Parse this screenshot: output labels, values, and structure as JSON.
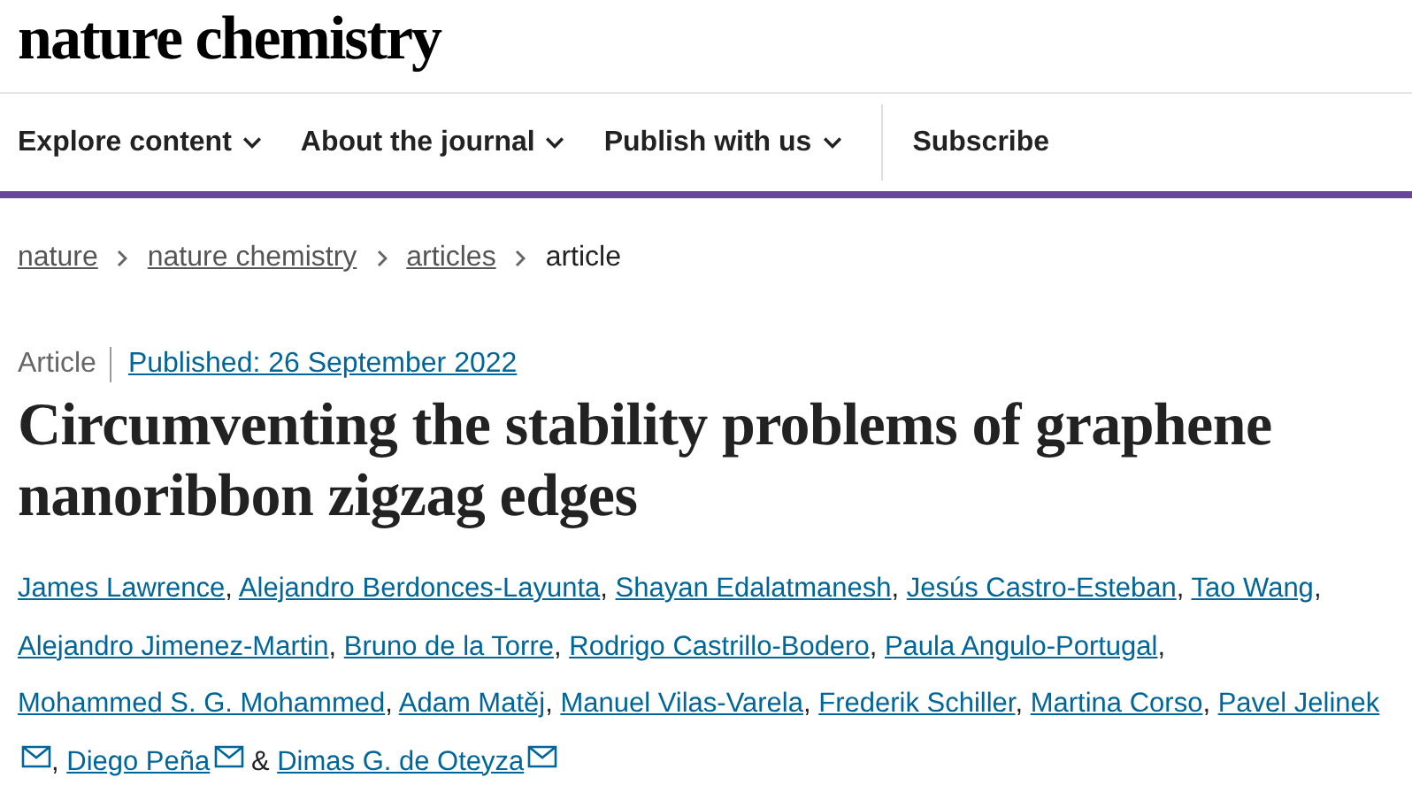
{
  "logo": "nature chemistry",
  "nav": [
    {
      "label": "Explore content",
      "dropdown": true
    },
    {
      "label": "About the journal",
      "dropdown": true
    },
    {
      "label": "Publish with us",
      "dropdown": true
    },
    {
      "label": "Subscribe",
      "dropdown": false
    }
  ],
  "breadcrumbs": [
    {
      "label": "nature",
      "link": true
    },
    {
      "label": "nature chemistry",
      "link": true
    },
    {
      "label": "articles",
      "link": true
    },
    {
      "label": "article",
      "link": false
    }
  ],
  "article_type": "Article",
  "published": "Published: 26 September 2022",
  "title": "Circumventing the stability problems of graphene nanoribbon zigzag edges",
  "authors": [
    {
      "name": "James Lawrence",
      "mail": false,
      "after": ", "
    },
    {
      "name": "Alejandro Berdonces-Layunta",
      "mail": false,
      "after": ", "
    },
    {
      "name": "Shayan Edalatmanesh",
      "mail": false,
      "after": ", "
    },
    {
      "name": "Jesús Castro-Esteban",
      "mail": false,
      "after": ", "
    },
    {
      "name": "Tao Wang",
      "mail": false,
      "after": ", "
    },
    {
      "name": "Alejandro Jimenez-Martin",
      "mail": false,
      "after": ", "
    },
    {
      "name": "Bruno de la Torre",
      "mail": false,
      "after": ", "
    },
    {
      "name": "Rodrigo Castrillo-Bodero",
      "mail": false,
      "after": ", "
    },
    {
      "name": "Paula Angulo-Portugal",
      "mail": false,
      "after": ", "
    },
    {
      "name": "Mohammed S. G. Mohammed",
      "mail": false,
      "after": ", "
    },
    {
      "name": "Adam Matěj",
      "mail": false,
      "after": ", "
    },
    {
      "name": "Manuel Vilas-Varela",
      "mail": false,
      "after": ", "
    },
    {
      "name": "Frederik Schiller",
      "mail": false,
      "after": ", "
    },
    {
      "name": "Martina Corso",
      "mail": false,
      "after": ", "
    },
    {
      "name": "Pavel Jelinek",
      "mail": true,
      "after": ", "
    },
    {
      "name": "Diego Peña",
      "mail": true,
      "after": " & "
    },
    {
      "name": "Dimas G. de Oteyza",
      "mail": true
    }
  ]
}
